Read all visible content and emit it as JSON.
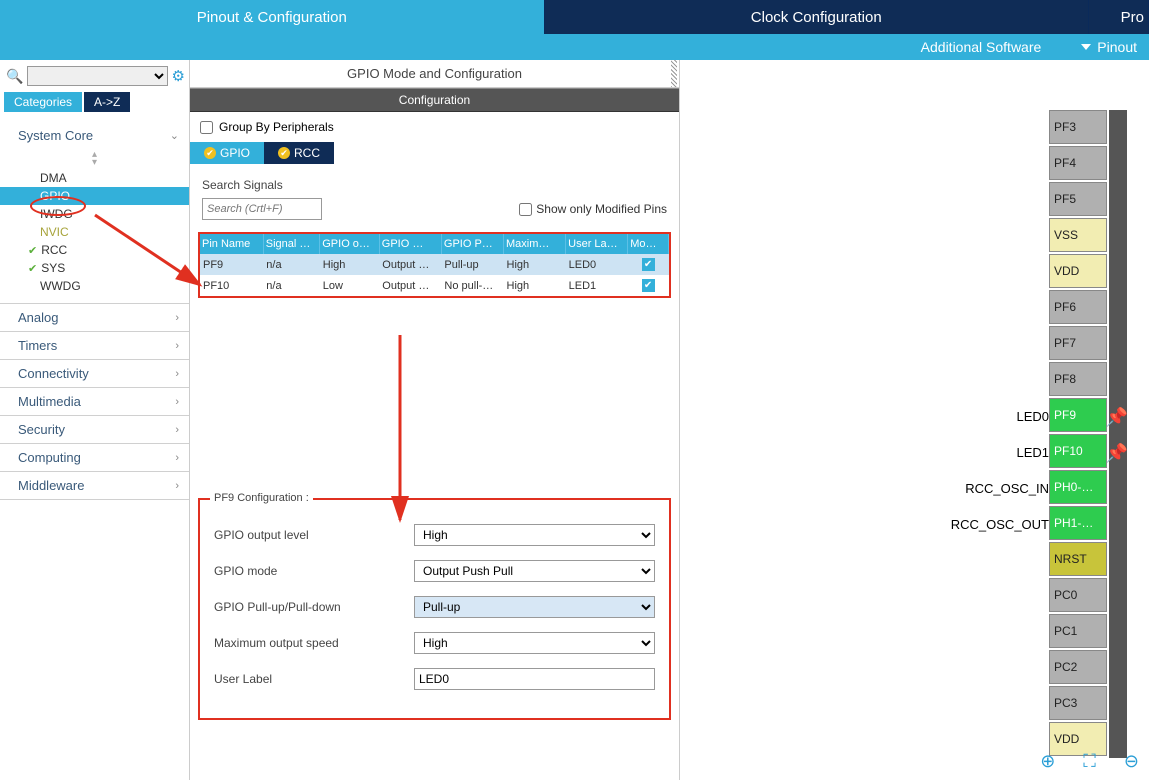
{
  "topbar": {
    "tabs": [
      "Pinout & Configuration",
      "Clock Configuration",
      "Pro"
    ],
    "active": 0
  },
  "subbar": {
    "additional": "Additional Software",
    "pinout": "Pinout"
  },
  "sidebar": {
    "cat_tabs": {
      "categories": "Categories",
      "az": "A->Z"
    },
    "groups": [
      {
        "label": "System Core",
        "open": true,
        "items": [
          {
            "label": "DMA"
          },
          {
            "label": "GPIO",
            "selected": true
          },
          {
            "label": "IWDG"
          },
          {
            "label": "NVIC",
            "warn": true
          },
          {
            "label": "RCC",
            "checked": true
          },
          {
            "label": "SYS",
            "checked": true
          },
          {
            "label": "WWDG"
          }
        ]
      },
      {
        "label": "Analog"
      },
      {
        "label": "Timers"
      },
      {
        "label": "Connectivity"
      },
      {
        "label": "Multimedia"
      },
      {
        "label": "Security"
      },
      {
        "label": "Computing"
      },
      {
        "label": "Middleware"
      }
    ]
  },
  "panel": {
    "title": "GPIO Mode and Configuration",
    "config_hdr": "Configuration",
    "group_by": "Group By Peripherals",
    "periph_tabs": {
      "gpio": "GPIO",
      "rcc": "RCC"
    },
    "search_label": "Search Signals",
    "search_ph": "Search (Crtl+F)",
    "show_modified": "Show only Modified Pins",
    "cols": [
      "Pin Name",
      "Signal …",
      "GPIO o…",
      "GPIO …",
      "GPIO P…",
      "Maxim…",
      "User La…",
      "Mo…"
    ],
    "rows": [
      {
        "pin": "PF9",
        "signal": "n/a",
        "out": "High",
        "mode": "Output …",
        "pull": "Pull-up",
        "speed": "High",
        "label": "LED0",
        "mod": true,
        "sel": true
      },
      {
        "pin": "PF10",
        "signal": "n/a",
        "out": "Low",
        "mode": "Output …",
        "pull": "No pull-…",
        "speed": "High",
        "label": "LED1",
        "mod": true
      }
    ],
    "pf9": {
      "legend": "PF9 Configuration :",
      "fields": {
        "output_level": {
          "label": "GPIO output level",
          "value": "High"
        },
        "mode": {
          "label": "GPIO mode",
          "value": "Output Push Pull"
        },
        "pull": {
          "label": "GPIO Pull-up/Pull-down",
          "value": "Pull-up"
        },
        "speed": {
          "label": "Maximum output speed",
          "value": "High"
        },
        "user_label": {
          "label": "User Label",
          "value": "LED0"
        }
      }
    }
  },
  "pins": [
    {
      "name": "PF3",
      "cls": "gray"
    },
    {
      "name": "PF4",
      "cls": "gray"
    },
    {
      "name": "PF5",
      "cls": "gray"
    },
    {
      "name": "VSS",
      "cls": "yellow"
    },
    {
      "name": "VDD",
      "cls": "yellow"
    },
    {
      "name": "PF6",
      "cls": "gray"
    },
    {
      "name": "PF7",
      "cls": "gray"
    },
    {
      "name": "PF8",
      "cls": "gray"
    },
    {
      "name": "PF9",
      "cls": "green",
      "left": "LED0",
      "pin": true
    },
    {
      "name": "PF10",
      "cls": "green",
      "left": "LED1",
      "pin": true
    },
    {
      "name": "PH0-…",
      "cls": "green",
      "left": "RCC_OSC_IN"
    },
    {
      "name": "PH1-…",
      "cls": "green",
      "left": "RCC_OSC_OUT"
    },
    {
      "name": "NRST",
      "cls": "olive"
    },
    {
      "name": "PC0",
      "cls": "gray"
    },
    {
      "name": "PC1",
      "cls": "gray"
    },
    {
      "name": "PC2",
      "cls": "gray"
    },
    {
      "name": "PC3",
      "cls": "gray"
    },
    {
      "name": "VDD",
      "cls": "yellow"
    }
  ]
}
